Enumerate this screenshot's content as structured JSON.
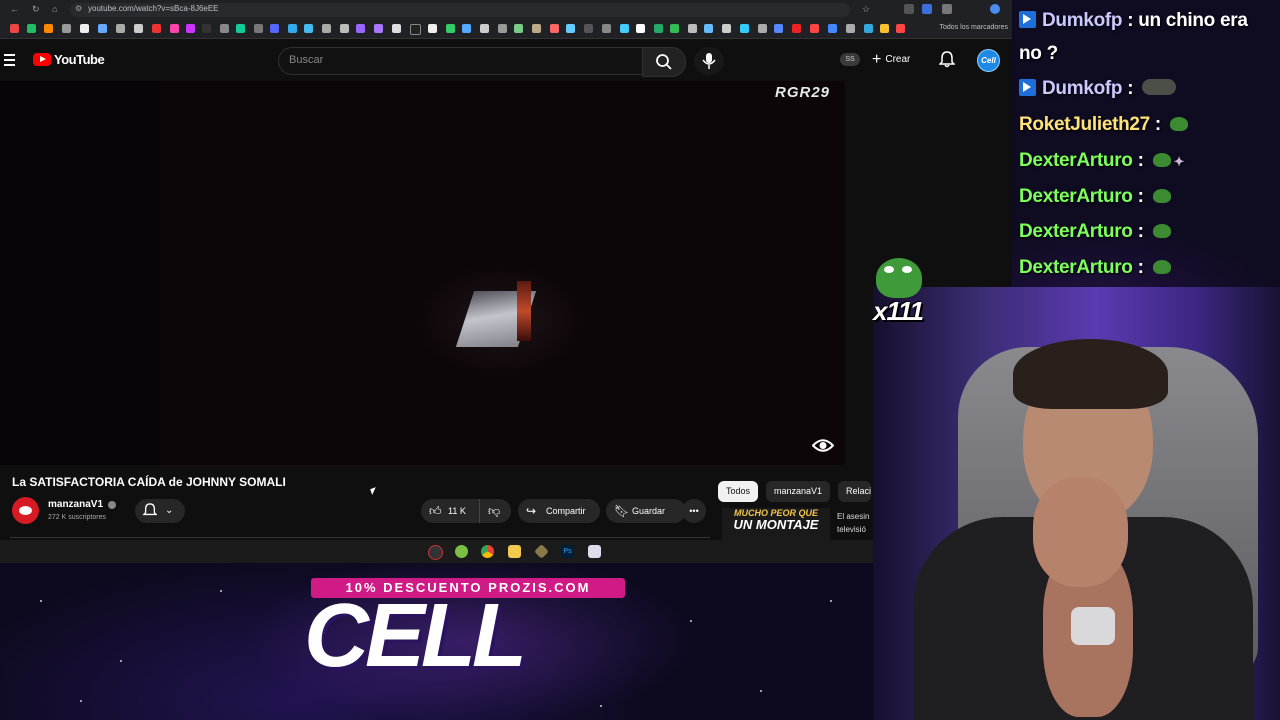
{
  "browser": {
    "url": "youtube.com/watch?v=sBca-8J6eEE",
    "bookmarks_label": "Todos los marcadores"
  },
  "youtube": {
    "logo_text": "YouTube",
    "search_placeholder": "Buscar",
    "ss_badge": "SS",
    "create_label": "Crear",
    "avatar_text": "Cell"
  },
  "video": {
    "watermark": "RGR29",
    "title": "La SATISFACTORIA CAÍDA de JOHNNY SOMALI",
    "channel": "manzanaV1",
    "subscribers": "272 K suscriptores",
    "likes": "11 K",
    "share_label": "Compartir",
    "save_label": "Guardar"
  },
  "recommendations": {
    "chips": [
      "Todos",
      "manzanaV1",
      "Relaci"
    ],
    "item": {
      "thumb_line1": "MUCHO PEOR QUE",
      "thumb_line2": "UN MONTAJE",
      "title_line1": "El asesin",
      "title_line2": "televisió"
    }
  },
  "chat": {
    "messages": [
      {
        "user": "Dumkofp",
        "text": " : un chino era",
        "color": "#c9c9ff",
        "badge": true
      },
      {
        "user": "",
        "text": "no ?",
        "color": "#ffffff",
        "badge": false
      },
      {
        "user": "Dumkofp",
        "text": " : ",
        "color": "#c9c9ff",
        "badge": true
      },
      {
        "user": "RoketJulieth27",
        "text": " : ",
        "color": "#ffe27a",
        "badge": false
      },
      {
        "user": "DexterArturo",
        "text": " : ",
        "color": "#7cff5a",
        "badge": false
      },
      {
        "user": "DexterArturo",
        "text": " : ",
        "color": "#7cff5a",
        "badge": false
      },
      {
        "user": "DexterArturo",
        "text": " : ",
        "color": "#7cff5a",
        "badge": false
      },
      {
        "user": "DexterArturo",
        "text": " : ",
        "color": "#7cff5a",
        "badge": false
      }
    ]
  },
  "overlay": {
    "emote_count": "x111",
    "promo_banner": "10% DESCUENTO PROZIS.COM",
    "promo_code": "CELL"
  },
  "colors": {
    "youtube_red": "#ff0000",
    "promo_pink": "#d01a86",
    "chat_green": "#7cff5a",
    "chat_gold": "#ffe27a"
  }
}
